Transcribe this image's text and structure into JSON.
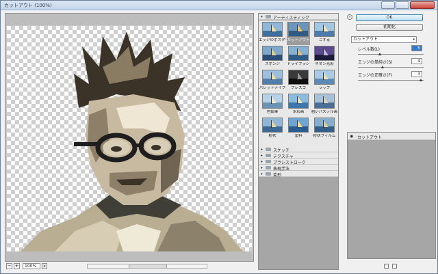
{
  "window": {
    "title": "カットアウト (100%)"
  },
  "canvas": {
    "zoom": "100%"
  },
  "gallery": {
    "categories": [
      {
        "name": "アーティスティック",
        "expanded": true
      },
      {
        "name": "スケッチ",
        "expanded": false
      },
      {
        "name": "テクスチャ",
        "expanded": false
      },
      {
        "name": "ブラシストローク",
        "expanded": false
      },
      {
        "name": "表現手法",
        "expanded": false
      },
      {
        "name": "変形",
        "expanded": false
      }
    ],
    "filters": [
      "エッジのポスタリゼーション",
      "カットアウト",
      "こする",
      "スポンジ",
      "ドライブラシ",
      "ネオン光彩",
      "パレットナイフ",
      "フレスコ",
      "ラップ",
      "色鉛筆",
      "水彩画",
      "粗いパステル画",
      "粒状",
      "塗料",
      "粒状フィルム"
    ],
    "selected_filter": "カットアウト"
  },
  "controls": {
    "ok_label": "OK",
    "reset_label": "初期化",
    "filter_select": "カットアウト",
    "params": [
      {
        "label": "レベル数(L)",
        "value": "5"
      },
      {
        "label": "エッジの単純さ(S)",
        "value": "4"
      },
      {
        "label": "エッジの正確さ(F)",
        "value": "3"
      }
    ]
  },
  "layers": {
    "items": [
      {
        "name": "カットアウト"
      }
    ]
  }
}
